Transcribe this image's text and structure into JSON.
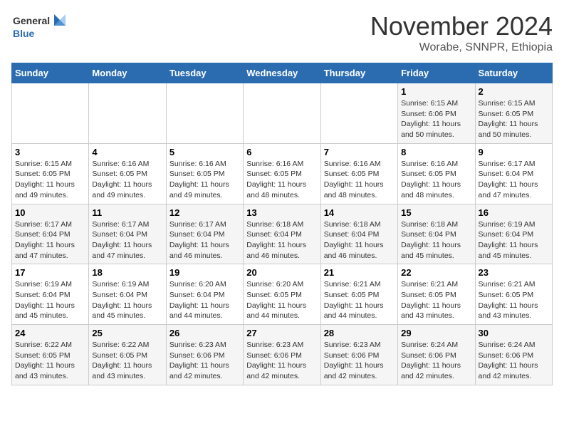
{
  "logo": {
    "line1": "General",
    "line2": "Blue"
  },
  "title": "November 2024",
  "location": "Worabe, SNNPR, Ethiopia",
  "weekdays": [
    "Sunday",
    "Monday",
    "Tuesday",
    "Wednesday",
    "Thursday",
    "Friday",
    "Saturday"
  ],
  "weeks": [
    [
      {
        "day": "",
        "info": ""
      },
      {
        "day": "",
        "info": ""
      },
      {
        "day": "",
        "info": ""
      },
      {
        "day": "",
        "info": ""
      },
      {
        "day": "",
        "info": ""
      },
      {
        "day": "1",
        "info": "Sunrise: 6:15 AM\nSunset: 6:06 PM\nDaylight: 11 hours and 50 minutes."
      },
      {
        "day": "2",
        "info": "Sunrise: 6:15 AM\nSunset: 6:05 PM\nDaylight: 11 hours and 50 minutes."
      }
    ],
    [
      {
        "day": "3",
        "info": "Sunrise: 6:15 AM\nSunset: 6:05 PM\nDaylight: 11 hours and 49 minutes."
      },
      {
        "day": "4",
        "info": "Sunrise: 6:16 AM\nSunset: 6:05 PM\nDaylight: 11 hours and 49 minutes."
      },
      {
        "day": "5",
        "info": "Sunrise: 6:16 AM\nSunset: 6:05 PM\nDaylight: 11 hours and 49 minutes."
      },
      {
        "day": "6",
        "info": "Sunrise: 6:16 AM\nSunset: 6:05 PM\nDaylight: 11 hours and 48 minutes."
      },
      {
        "day": "7",
        "info": "Sunrise: 6:16 AM\nSunset: 6:05 PM\nDaylight: 11 hours and 48 minutes."
      },
      {
        "day": "8",
        "info": "Sunrise: 6:16 AM\nSunset: 6:05 PM\nDaylight: 11 hours and 48 minutes."
      },
      {
        "day": "9",
        "info": "Sunrise: 6:17 AM\nSunset: 6:04 PM\nDaylight: 11 hours and 47 minutes."
      }
    ],
    [
      {
        "day": "10",
        "info": "Sunrise: 6:17 AM\nSunset: 6:04 PM\nDaylight: 11 hours and 47 minutes."
      },
      {
        "day": "11",
        "info": "Sunrise: 6:17 AM\nSunset: 6:04 PM\nDaylight: 11 hours and 47 minutes."
      },
      {
        "day": "12",
        "info": "Sunrise: 6:17 AM\nSunset: 6:04 PM\nDaylight: 11 hours and 46 minutes."
      },
      {
        "day": "13",
        "info": "Sunrise: 6:18 AM\nSunset: 6:04 PM\nDaylight: 11 hours and 46 minutes."
      },
      {
        "day": "14",
        "info": "Sunrise: 6:18 AM\nSunset: 6:04 PM\nDaylight: 11 hours and 46 minutes."
      },
      {
        "day": "15",
        "info": "Sunrise: 6:18 AM\nSunset: 6:04 PM\nDaylight: 11 hours and 45 minutes."
      },
      {
        "day": "16",
        "info": "Sunrise: 6:19 AM\nSunset: 6:04 PM\nDaylight: 11 hours and 45 minutes."
      }
    ],
    [
      {
        "day": "17",
        "info": "Sunrise: 6:19 AM\nSunset: 6:04 PM\nDaylight: 11 hours and 45 minutes."
      },
      {
        "day": "18",
        "info": "Sunrise: 6:19 AM\nSunset: 6:04 PM\nDaylight: 11 hours and 45 minutes."
      },
      {
        "day": "19",
        "info": "Sunrise: 6:20 AM\nSunset: 6:04 PM\nDaylight: 11 hours and 44 minutes."
      },
      {
        "day": "20",
        "info": "Sunrise: 6:20 AM\nSunset: 6:05 PM\nDaylight: 11 hours and 44 minutes."
      },
      {
        "day": "21",
        "info": "Sunrise: 6:21 AM\nSunset: 6:05 PM\nDaylight: 11 hours and 44 minutes."
      },
      {
        "day": "22",
        "info": "Sunrise: 6:21 AM\nSunset: 6:05 PM\nDaylight: 11 hours and 43 minutes."
      },
      {
        "day": "23",
        "info": "Sunrise: 6:21 AM\nSunset: 6:05 PM\nDaylight: 11 hours and 43 minutes."
      }
    ],
    [
      {
        "day": "24",
        "info": "Sunrise: 6:22 AM\nSunset: 6:05 PM\nDaylight: 11 hours and 43 minutes."
      },
      {
        "day": "25",
        "info": "Sunrise: 6:22 AM\nSunset: 6:05 PM\nDaylight: 11 hours and 43 minutes."
      },
      {
        "day": "26",
        "info": "Sunrise: 6:23 AM\nSunset: 6:06 PM\nDaylight: 11 hours and 42 minutes."
      },
      {
        "day": "27",
        "info": "Sunrise: 6:23 AM\nSunset: 6:06 PM\nDaylight: 11 hours and 42 minutes."
      },
      {
        "day": "28",
        "info": "Sunrise: 6:23 AM\nSunset: 6:06 PM\nDaylight: 11 hours and 42 minutes."
      },
      {
        "day": "29",
        "info": "Sunrise: 6:24 AM\nSunset: 6:06 PM\nDaylight: 11 hours and 42 minutes."
      },
      {
        "day": "30",
        "info": "Sunrise: 6:24 AM\nSunset: 6:06 PM\nDaylight: 11 hours and 42 minutes."
      }
    ]
  ]
}
